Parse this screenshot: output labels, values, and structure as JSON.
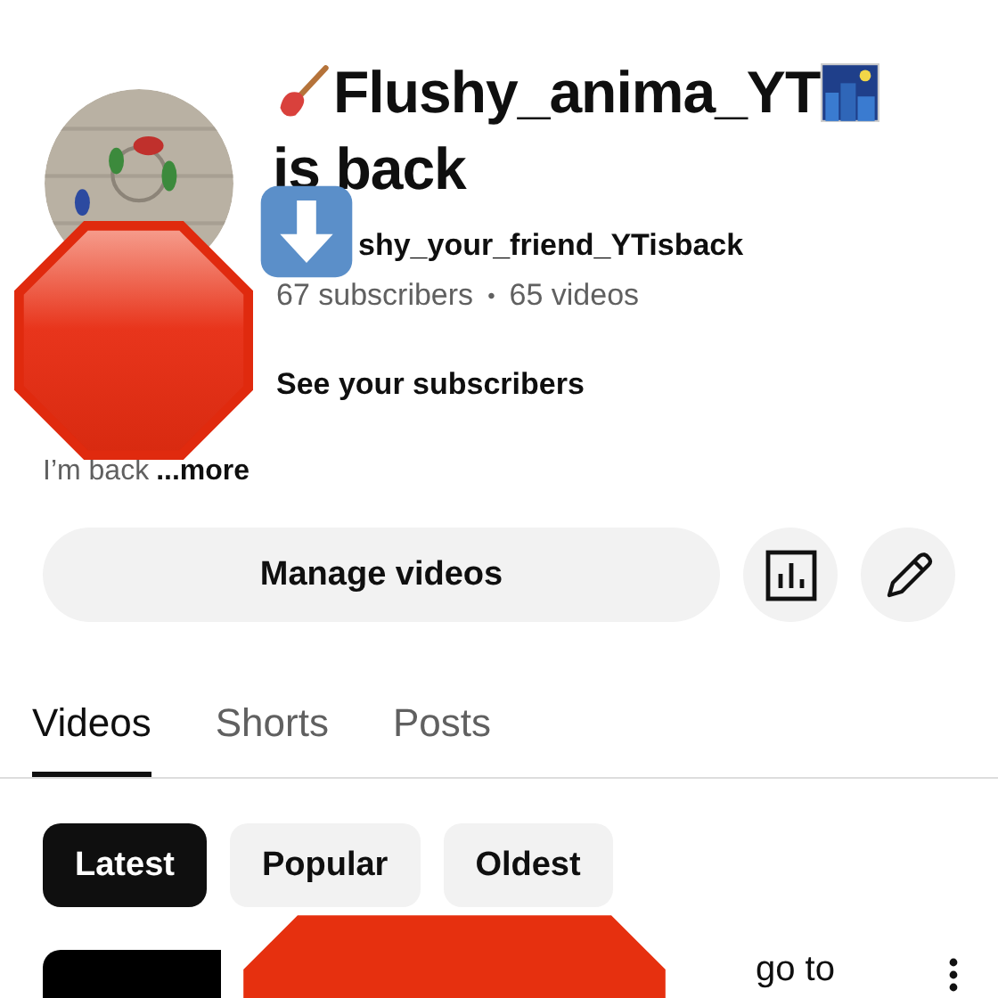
{
  "channel": {
    "title_line_1": "Flushy_anima_YT",
    "title_line_2": "is back",
    "handle": "shy_your_friend_YTisback",
    "subscribers": "67 subscribers",
    "separator": "•",
    "videos": "65 videos",
    "subscribers_link": "See your subscribers",
    "description": "I’m back",
    "more": "...more"
  },
  "actions": {
    "manage": "Manage videos"
  },
  "tabs": [
    {
      "label": "Videos",
      "selected": true
    },
    {
      "label": "Shorts",
      "selected": false
    },
    {
      "label": "Posts",
      "selected": false
    }
  ],
  "chips": [
    {
      "label": "Latest",
      "selected": true
    },
    {
      "label": "Popular",
      "selected": false
    },
    {
      "label": "Oldest",
      "selected": false
    }
  ],
  "video": {
    "title_fragment": "go to"
  }
}
